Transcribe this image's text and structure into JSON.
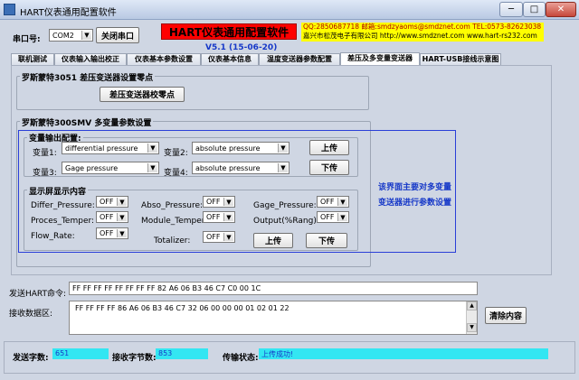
{
  "window": {
    "title": "HART仪表通用配置软件",
    "minimize": "─",
    "maximize": "□",
    "close": "✕"
  },
  "header": {
    "com_label": "串口号:",
    "com_value": "COM2",
    "close_port_label": "关闭串口",
    "banner": "HART仪表通用配置软件",
    "version": "V5.1 (15-06-20)",
    "contact_line1": "QQ:2850687718  邮箱:smdzyaoms@smdznet.com TEL:0573-82623038",
    "contact_line2": "嘉兴市松茂电子有限公司 http://www.smdznet.com  www.hart-rs232.com"
  },
  "tabs": [
    "联机测试",
    "仪表输入输出校正",
    "仪表基本参数设置",
    "仪表基本信息",
    "温度变送器参数配置",
    "差压及多变量变送器",
    "HART-USB接线示意图"
  ],
  "rosemount3051": {
    "title": "罗斯蒙特3051 差压变送器设置零点",
    "zero_button": "差压变送器校零点"
  },
  "rosemount300smv": {
    "title": "罗斯蒙特300SMV 多变量参数设置",
    "output_config": {
      "title": "变量输出配置:",
      "var1_label": "变量1:",
      "var1_value": "differential pressure",
      "var2_label": "变量2:",
      "var2_value": "absolute pressure",
      "var3_label": "变量3:",
      "var3_value": "Gage pressure",
      "var4_label": "变量4:",
      "var4_value": "absolute pressure",
      "upload_label": "上传",
      "download_label": "下传"
    },
    "display": {
      "title": "显示屏显示内容",
      "items": [
        {
          "label": "Differ_Pressure:",
          "value": "OFF"
        },
        {
          "label": "Abso_Pressure:",
          "value": "OFF"
        },
        {
          "label": "Gage_Pressure:",
          "value": "OFF"
        },
        {
          "label": "Proces_Temper:",
          "value": "OFF"
        },
        {
          "label": "Module_Temper:",
          "value": "OFF"
        },
        {
          "label": "Output(%Rang):",
          "value": "OFF"
        },
        {
          "label": "Flow_Rate:",
          "value": "OFF"
        },
        {
          "label": "Totalizer:",
          "value": "OFF"
        }
      ],
      "upload_label": "上传",
      "download_label": "下传"
    },
    "note_line1": "该界面主要对多变量",
    "note_line2": "变送器进行参数设置"
  },
  "hart_send": {
    "label": "发送HART命令:",
    "value": "FF FF FF FF FF FF FF FF 82 A6 06 B3 46 C7 C0 00 1C"
  },
  "receive": {
    "label": "接收数据区:",
    "value": "FF FF FF FF 86 A6 06 B3 46 C7 32 06 00 00 00 01 02 01 22",
    "clear_label": "清除内容"
  },
  "status": {
    "sent_label": "发送字数:",
    "sent_value": "651",
    "recv_label": "接收字节数:",
    "recv_value": "853",
    "state_label": "传输状态:",
    "state_value": "上传成功!"
  },
  "colors": {
    "banner_bg": "#ff0000",
    "contact_bg": "#ffff00",
    "status_bg": "#33e6f2",
    "highlight_border": "#2a3fd8"
  }
}
